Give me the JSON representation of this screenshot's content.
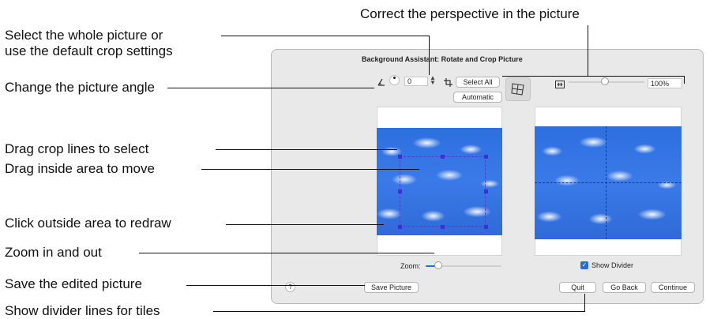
{
  "callouts": {
    "perspective": "Correct the perspective in the picture",
    "select_line1": "Select the whole picture or",
    "select_line2": "use the default crop settings",
    "angle": "Change the picture angle",
    "drag_crop": "Drag crop lines to select",
    "drag_inside": "Drag inside area to move",
    "click_outside": "Click outside area to redraw",
    "zoom": "Zoom in and out",
    "save": "Save the edited picture",
    "divider": "Show divider lines for tiles"
  },
  "dialog": {
    "title": "Background Assistant: Rotate and Crop Picture",
    "angle_value": "0",
    "select_all_label": "Select All",
    "automatic_label": "Automatic",
    "zoom_percent": "100%",
    "zoom_label": "Zoom:",
    "show_divider_label": "Show Divider",
    "show_divider_checked": true,
    "help_label": "?",
    "save_picture_label": "Save Picture",
    "quit_label": "Quit",
    "go_back_label": "Go Back",
    "continue_label": "Continue"
  },
  "icons": {
    "angle": "angle-icon",
    "dial": "rotation-dial-icon",
    "stepper": "stepper-icon",
    "crop": "crop-icon",
    "perspective": "perspective-grid-icon",
    "fit": "fit-width-icon"
  },
  "colors": {
    "accent": "#2a6be0",
    "crop_handle": "#3b2fd6",
    "sky": "#3a7ae8"
  }
}
